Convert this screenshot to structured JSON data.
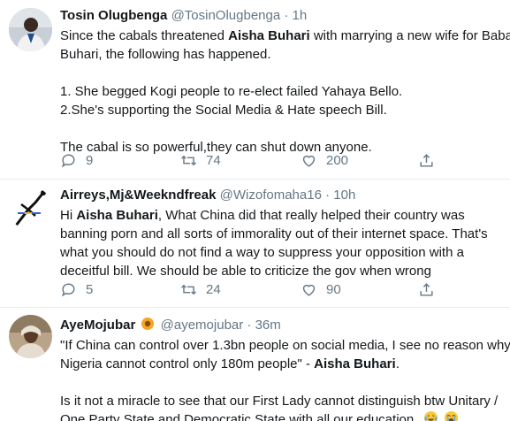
{
  "tweets": [
    {
      "name": "Tosin Olugbenga",
      "handle": "@TosinOlugbenga",
      "separator": "·",
      "time": "1h",
      "text": {
        "l1a": "Since the cabals threatened ",
        "l1b": "Aisha Buhari",
        "l1c": " with marrying a new wife for Baba",
        "l2": "Buhari, the following has happened.",
        "l3": "1. She begged Kogi people to re-elect failed Yahaya Bello.",
        "l4": "2.She's supporting the Social Media & Hate speech Bill.",
        "l5": "The cabal is so powerful,they can shut down anyone."
      },
      "replies": "9",
      "retweets": "74",
      "likes": "200"
    },
    {
      "name": "Airreys,Mj&Weekndfreak",
      "handle": "@Wizofomaha16",
      "separator": "·",
      "time": "10h",
      "text": {
        "l1a": "Hi ",
        "l1b": "Aisha Buhari",
        "l1c": ", What China did that really helped their country was",
        "l2": "banning porn and all sorts of immorality out of their internet space. That's",
        "l3": "what you should do not find a way to suppress your opposition with a",
        "l4": "deceitful bill. We should be able to criticize the gov when wrong"
      },
      "replies": "5",
      "retweets": "24",
      "likes": "90"
    },
    {
      "name": "AyeMojubar",
      "handle": "@ayemojubar",
      "separator": "·",
      "time": "36m",
      "text": {
        "l1": "\"If China can control over 1.3bn people on social media, I see no reason why",
        "l2a": "Nigeria cannot control only 180m people\" - ",
        "l2b": "Aisha Buhari",
        "l2c": ".",
        "l3": "Is it not a miracle to see that our First Lady cannot distinguish btw Unitary /",
        "l4": "One Party State and Democratic State with all our education."
      }
    }
  ],
  "icons": {
    "reply": "speech-bubble-icon",
    "retweet": "retweet-arrows-icon",
    "like": "heart-icon",
    "share": "share-upload-icon",
    "badge": "sunflower-badge-icon",
    "emoji1": "tears-of-joy-emoji",
    "emoji2": "loudly-crying-emoji"
  },
  "colors": {
    "text": "#14171a",
    "muted": "#657786",
    "divider": "#e6ecf0",
    "badge": "#f5a623"
  }
}
